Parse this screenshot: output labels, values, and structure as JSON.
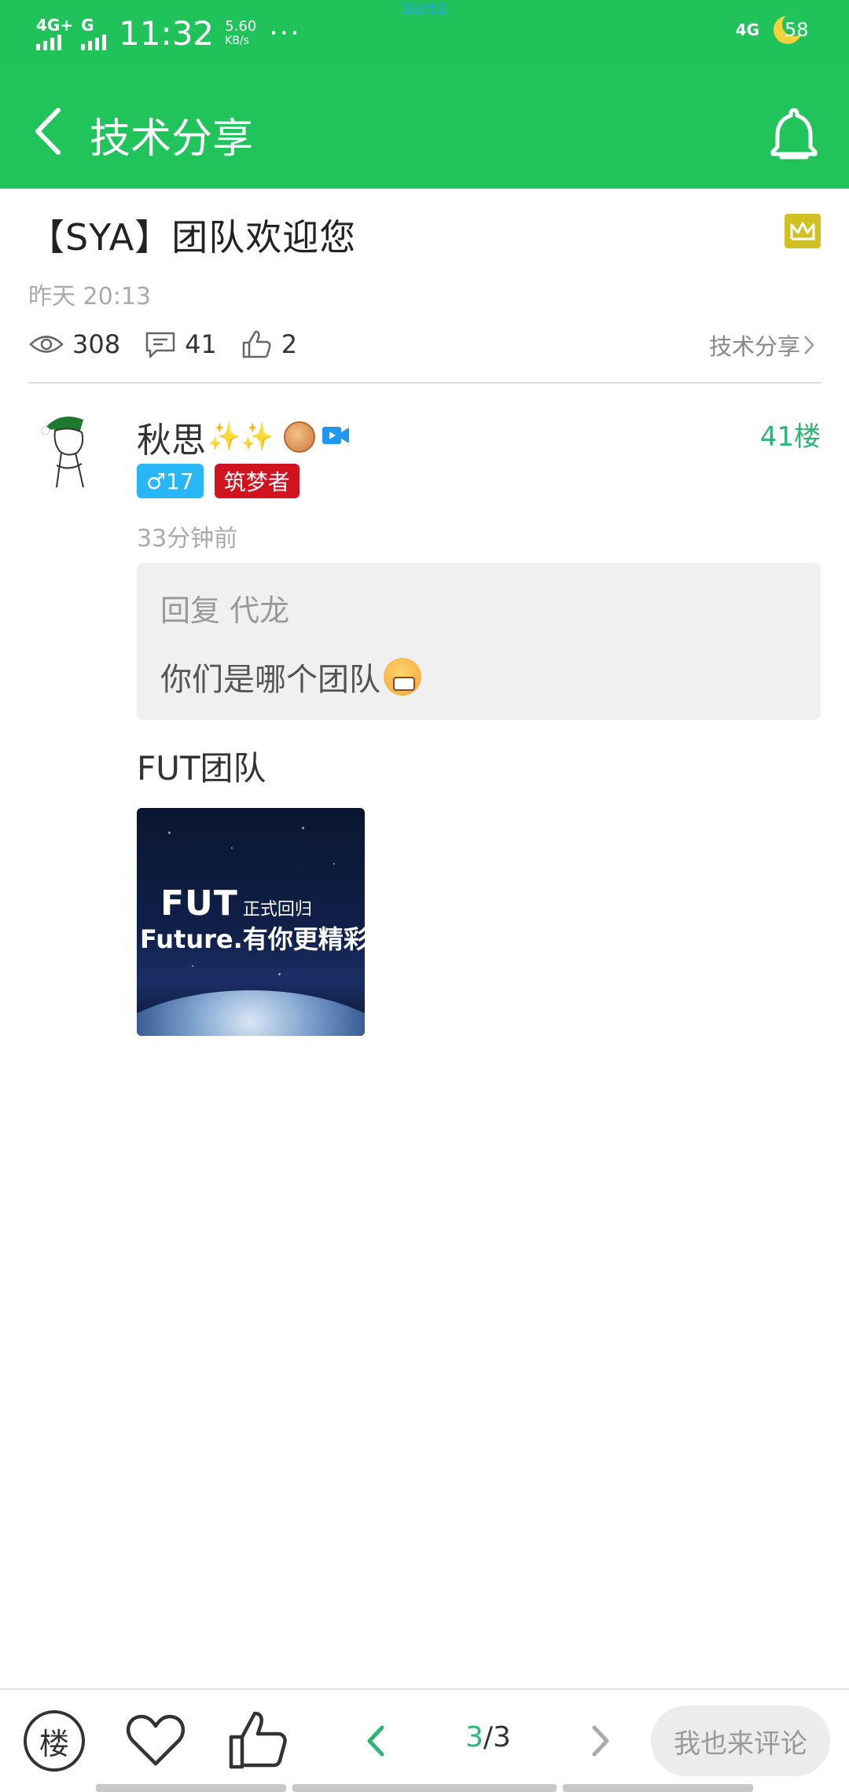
{
  "status_bar": {
    "sim1_tag": "4G+",
    "sim2_tag": "G",
    "time": "11:32",
    "speed_value": "5.60",
    "speed_unit": "KB/s",
    "more": "···",
    "top_center": "漫画社区",
    "right_net": "4G",
    "battery": "58"
  },
  "app_bar": {
    "title": "技术分享",
    "back_icon": "chevron-left-icon",
    "bell_icon": "bell-icon"
  },
  "post": {
    "title": "【SYA】团队欢迎您",
    "time": "昨天 20:13",
    "views": "308",
    "comments": "41",
    "likes": "2",
    "category": "技术分享",
    "badge_color": "#cfc023"
  },
  "comment": {
    "author": "秋思",
    "sparkles": "✨✨",
    "floor": "41楼",
    "gender_level": "♂17",
    "title_badge": "筑梦者",
    "time": "33分钟前",
    "quote_header": "回复 代龙",
    "quote_text": "你们是哪个团队",
    "body": "FUT团队",
    "image_line1_big": "FUT",
    "image_line1_small": "正式回归",
    "image_line2": "Future.有你更精彩"
  },
  "bottom_bar": {
    "floor_label": "楼",
    "page_current": "3",
    "page_sep": "/",
    "page_total": "3",
    "comment_placeholder": "我也来评论"
  },
  "colors": {
    "primary_green": "#20c45b",
    "floor_green": "#2bb673",
    "gender_blue": "#29b6f6",
    "title_red": "#d2121e"
  }
}
